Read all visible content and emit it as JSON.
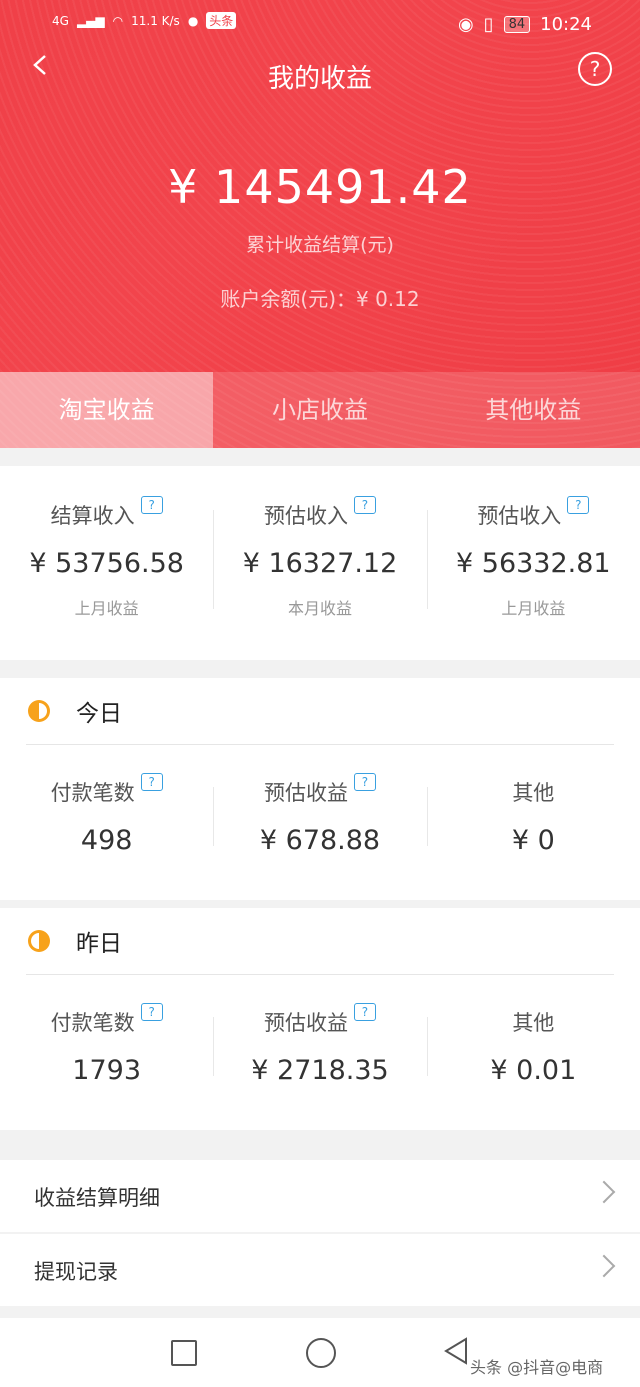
{
  "status": {
    "network": "4G",
    "speed": "11.1 K/s",
    "badge": "头条",
    "battery": "84",
    "time": "10:24"
  },
  "header": {
    "title": "我的收益",
    "help_icon": "question-circle-icon"
  },
  "summary": {
    "total": "¥ 145491.42",
    "total_label": "累计收益结算(元)",
    "balance": "账户余额(元)：¥ 0.12"
  },
  "tabs": [
    {
      "label": "淘宝收益"
    },
    {
      "label": "小店收益"
    },
    {
      "label": "其他收益"
    }
  ],
  "overview": [
    {
      "label": "结算收入",
      "value": "¥ 53756.58",
      "sub": "上月收益"
    },
    {
      "label": "预估收入",
      "value": "¥ 16327.12",
      "sub": "本月收益"
    },
    {
      "label": "预估收入",
      "value": "¥ 56332.81",
      "sub": "上月收益"
    }
  ],
  "today": {
    "title": "今日",
    "stats": [
      {
        "label": "付款笔数",
        "value": "498"
      },
      {
        "label": "预估收益",
        "value": "¥ 678.88"
      },
      {
        "label": "其他",
        "value": "¥ 0"
      }
    ]
  },
  "yesterday": {
    "title": "昨日",
    "stats": [
      {
        "label": "付款笔数",
        "value": "1793"
      },
      {
        "label": "预估收益",
        "value": "¥ 2718.35"
      },
      {
        "label": "其他",
        "value": "¥ 0.01"
      }
    ]
  },
  "links": [
    {
      "label": "收益结算明细"
    },
    {
      "label": "提现记录"
    }
  ],
  "watermark": "头条 @抖音@电商",
  "colors": {
    "brand": "#f04048",
    "accent_icon": "#39a0e0",
    "sun": "#f7a21b"
  }
}
